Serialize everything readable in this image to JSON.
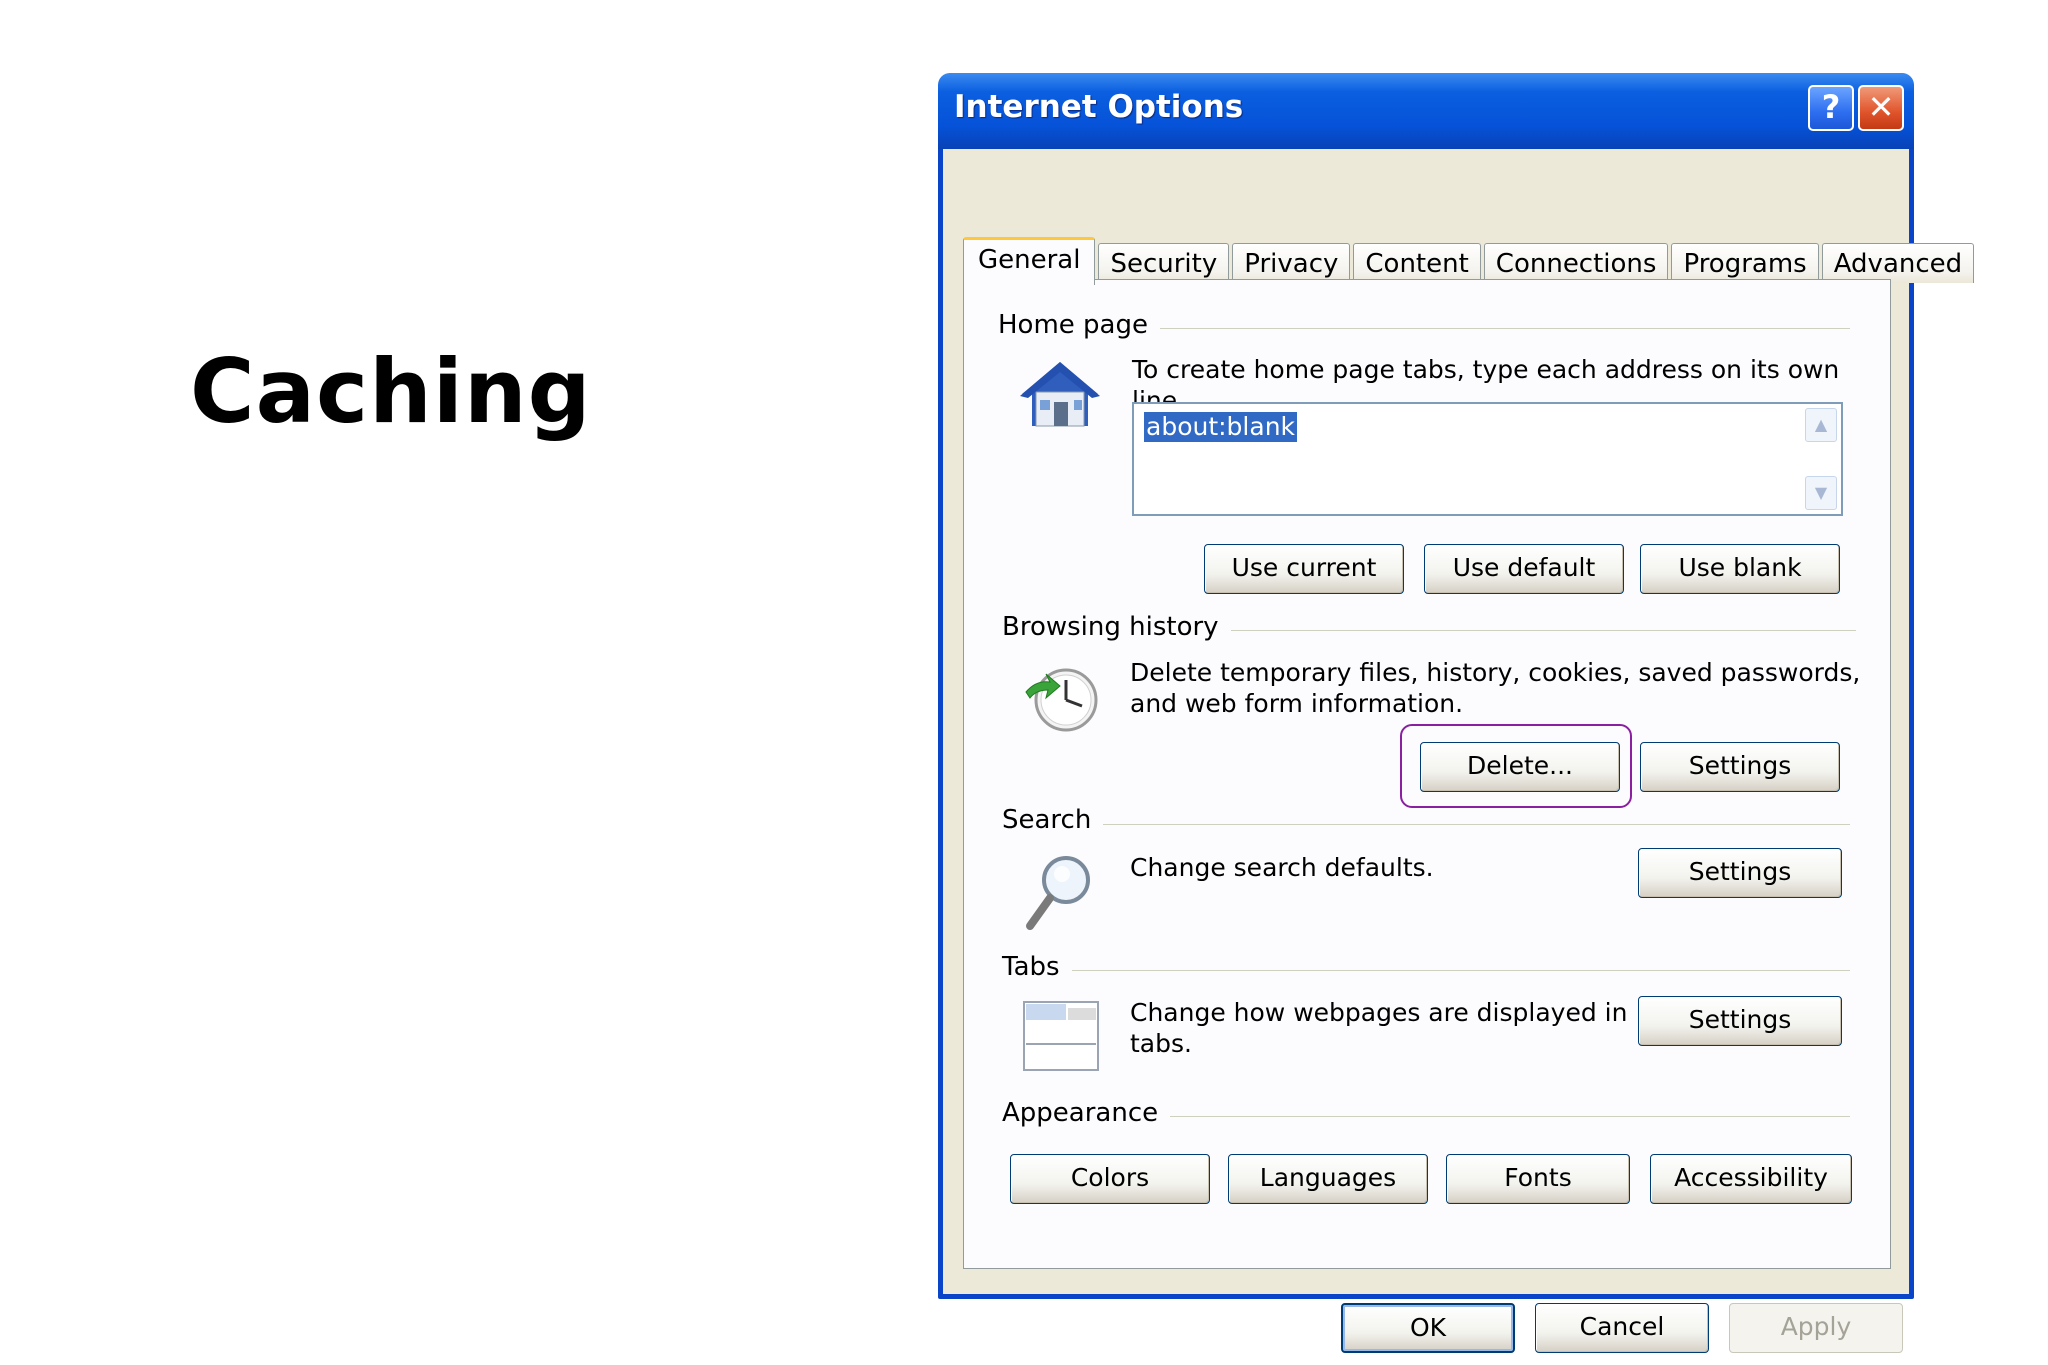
{
  "slide": {
    "title": "Caching"
  },
  "window": {
    "title": "Internet Options",
    "help_glyph": "?",
    "close_glyph": "✕"
  },
  "tabs": [
    {
      "label": "General",
      "active": true
    },
    {
      "label": "Security"
    },
    {
      "label": "Privacy"
    },
    {
      "label": "Content"
    },
    {
      "label": "Connections"
    },
    {
      "label": "Programs"
    },
    {
      "label": "Advanced"
    }
  ],
  "home_page": {
    "heading": "Home page",
    "description": "To create home page tabs, type each address on its own line.",
    "address_value": "about:blank",
    "use_current": "Use current",
    "use_default": "Use default",
    "use_blank": "Use blank"
  },
  "browsing_history": {
    "heading": "Browsing history",
    "description_line1": "Delete temporary files, history, cookies, saved passwords,",
    "description_line2": "and web form information.",
    "delete_label": "Delete...",
    "settings_label": "Settings"
  },
  "search": {
    "heading": "Search",
    "description": "Change search defaults.",
    "settings_label": "Settings"
  },
  "tabs_group": {
    "heading": "Tabs",
    "description_line1": "Change how webpages are displayed in",
    "description_line2": "tabs.",
    "settings_label": "Settings"
  },
  "appearance": {
    "heading": "Appearance",
    "colors": "Colors",
    "languages": "Languages",
    "fonts": "Fonts",
    "accessibility": "Accessibility"
  },
  "footer": {
    "ok": "OK",
    "cancel": "Cancel",
    "apply": "Apply"
  },
  "colors": {
    "titlebar": "#0652d8",
    "highlight_ring": "#8a1fa0",
    "selection": "#316ac5"
  }
}
